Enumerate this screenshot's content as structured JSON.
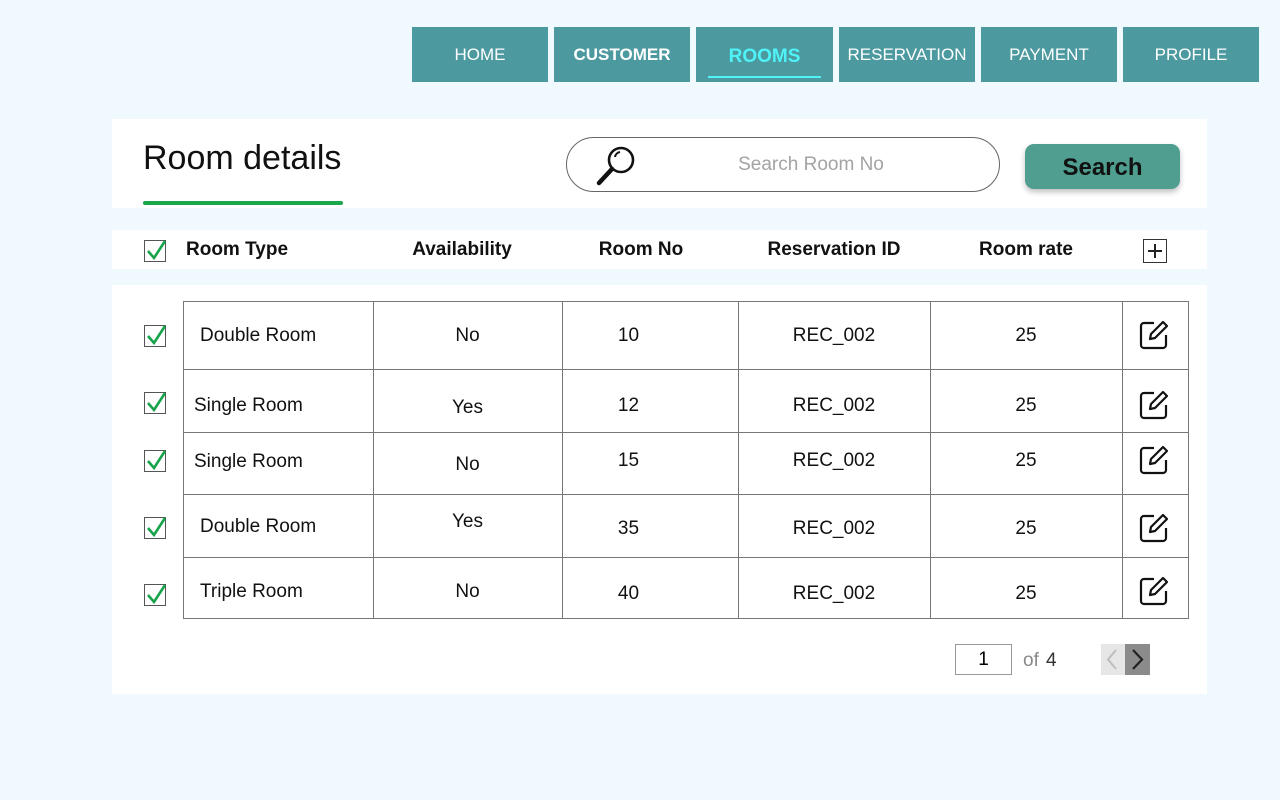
{
  "nav": {
    "items": [
      {
        "label": "HOME"
      },
      {
        "label": "CUSTOMER"
      },
      {
        "label": "ROOMS"
      },
      {
        "label": "RESERVATION"
      },
      {
        "label": "PAYMENT"
      },
      {
        "label": "PROFILE"
      }
    ],
    "active": "ROOMS"
  },
  "header": {
    "title": "Room details",
    "search_placeholder": "Search Room No",
    "search_button": "Search"
  },
  "table": {
    "columns": [
      "Room Type",
      "Availability",
      "Room No",
      "Reservation ID",
      "Room rate"
    ],
    "rows": [
      {
        "room_type": "Double Room",
        "availability": "No",
        "room_no": "10",
        "reservation_id": "REC_002",
        "room_rate": "25",
        "checked": true
      },
      {
        "room_type": "Single Room",
        "availability": "Yes",
        "room_no": "12",
        "reservation_id": "REC_002",
        "room_rate": "25",
        "checked": true
      },
      {
        "room_type": "Single Room",
        "availability": "No",
        "room_no": "15",
        "reservation_id": "REC_002",
        "room_rate": "25",
        "checked": true
      },
      {
        "room_type": "Double Room",
        "availability": "Yes",
        "room_no": "35",
        "reservation_id": "REC_002",
        "room_rate": "25",
        "checked": true
      },
      {
        "room_type": "Triple Room",
        "availability": "No",
        "room_no": "40",
        "reservation_id": "REC_002",
        "room_rate": "25",
        "checked": true
      }
    ]
  },
  "pagination": {
    "current_page": "1",
    "of_label": "of",
    "total_pages": "4"
  },
  "colors": {
    "nav_bg": "#4c9aa0",
    "nav_active_text": "#4ff2f6",
    "accent_green": "#1aa64a",
    "search_button_bg": "#4f9e8f",
    "page_bg": "#eff9fe"
  },
  "icons": {
    "search": "search-icon",
    "checkbox": "checkmark-icon",
    "add": "plus-icon",
    "edit": "edit-icon",
    "prev": "chevron-left-icon",
    "next": "chevron-right-icon"
  }
}
